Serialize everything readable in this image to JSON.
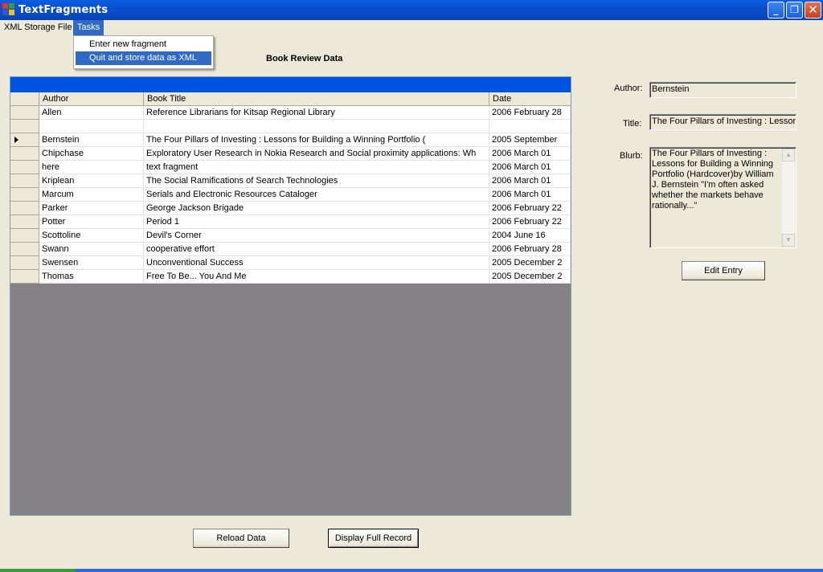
{
  "window": {
    "title": "TextFragments"
  },
  "menu": {
    "items": [
      {
        "label": "XML Storage File"
      },
      {
        "label": "Tasks"
      }
    ],
    "tasks_dropdown": [
      {
        "label": "Enter new fragment"
      },
      {
        "label": "Quit and store data as XML"
      }
    ]
  },
  "section_title": "Book Review Data",
  "grid": {
    "columns": [
      "Author",
      "Book Title",
      "Date"
    ],
    "rows": [
      {
        "author": "Allen",
        "title": "Reference Librarians for Kitsap Regional Library",
        "date": "2006  February 28"
      },
      {
        "author": "",
        "title": "",
        "date": ""
      },
      {
        "author": "Bernstein",
        "title": "The Four Pillars of Investing : Lessons for Building a Winning Portfolio (",
        "date": "2005  September"
      },
      {
        "author": "Chipchase",
        "title": "Exploratory User Research in Nokia Research and Social proximity applications: Wh",
        "date": "2006  March 01"
      },
      {
        "author": "here",
        "title": "text fragment",
        "date": "2006  March 01"
      },
      {
        "author": "Kriplean",
        "title": "The Social Ramifications of Search Technologies",
        "date": "2006  March 01"
      },
      {
        "author": "Marcum",
        "title": "Serials and Electronic Resources Cataloger",
        "date": "2006  March 01"
      },
      {
        "author": "Parker",
        "title": "George Jackson Brigade",
        "date": "2006  February 22"
      },
      {
        "author": "Potter",
        "title": "Period 1",
        "date": "2006  February 22"
      },
      {
        "author": "Scottoline",
        "title": "Devil's Corner",
        "date": "2004  June 16"
      },
      {
        "author": "Swann",
        "title": "cooperative effort",
        "date": "2006  February 28"
      },
      {
        "author": "Swensen",
        "title": "Unconventional Success",
        "date": "2005  December 2"
      },
      {
        "author": "Thomas",
        "title": "Free To Be... You And Me",
        "date": "2005  December 2"
      }
    ]
  },
  "details": {
    "author_label": "Author:",
    "author_value": "Bernstein",
    "title_label": "Title:",
    "title_value": "The Four Pillars of Investing : Lessons",
    "blurb_label": "Blurb:",
    "blurb_value": "The Four Pillars of Investing : Lessons for Building a Winning Portfolio (Hardcover)by William J. Bernstein \"I'm often asked whether the markets behave rationally...\"",
    "edit_button": "Edit Entry"
  },
  "buttons": {
    "reload": "Reload Data",
    "display_full": "Display Full Record"
  },
  "colors": {
    "titlebar": "#0a4fd1",
    "menu_highlight": "#316ac5",
    "grid_caption": "#0054e3",
    "grid_empty": "#848284",
    "window_bg": "#ece9d8"
  },
  "icons": [
    "app-icon",
    "minimize-icon",
    "restore-icon",
    "close-icon",
    "row-selector-arrow-icon",
    "scroll-up-icon",
    "scroll-down-icon"
  ]
}
